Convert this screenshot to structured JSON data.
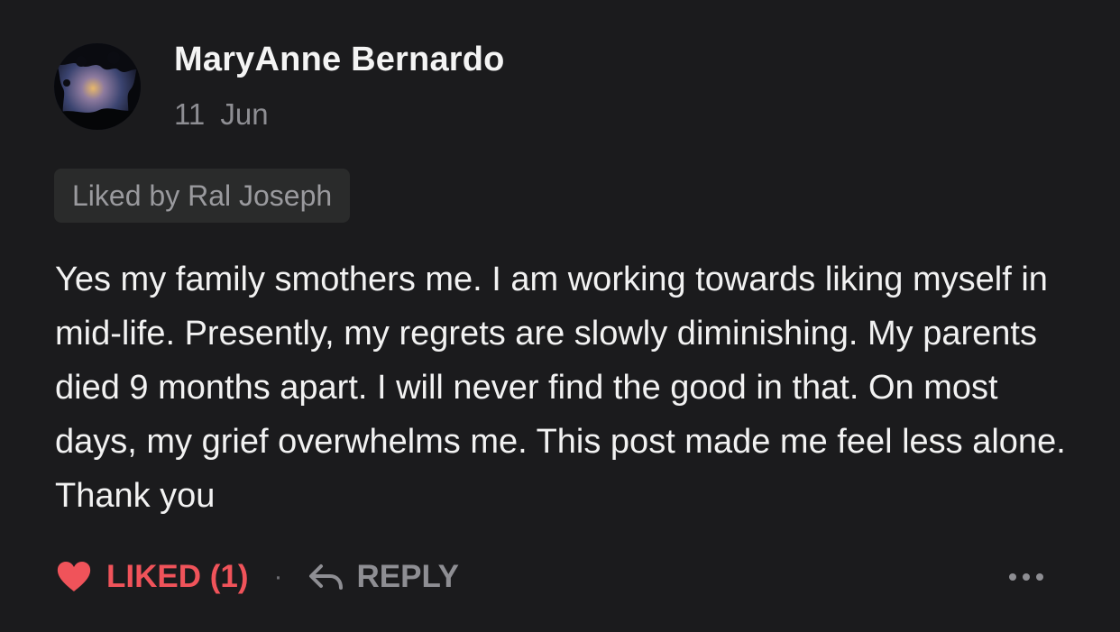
{
  "comment": {
    "author": "MaryAnne Bernardo",
    "date": "11 Jun",
    "liked_by": "Liked by Ral Joseph",
    "body": "Yes my family smothers me. I am working towards liking myself in mid-life. Presently, my regrets are slowly diminishing. My parents died 9 months apart. I will never find the good in that. On most days, my grief overwhelms me. This post made me feel less alone. Thank you",
    "avatar_icon": "avatar-sunset-photo"
  },
  "actions": {
    "like_label": "LIKED (1)",
    "like_icon": "heart-icon",
    "separator": "·",
    "reply_label": "REPLY",
    "reply_icon": "reply-arrow-icon",
    "more_icon": "more-dots-icon"
  },
  "colors": {
    "background": "#1b1b1d",
    "text": "#f2f2f2",
    "muted": "#8e8e93",
    "liked_accent": "#f0535a",
    "chip_background": "#2a2b2b"
  }
}
